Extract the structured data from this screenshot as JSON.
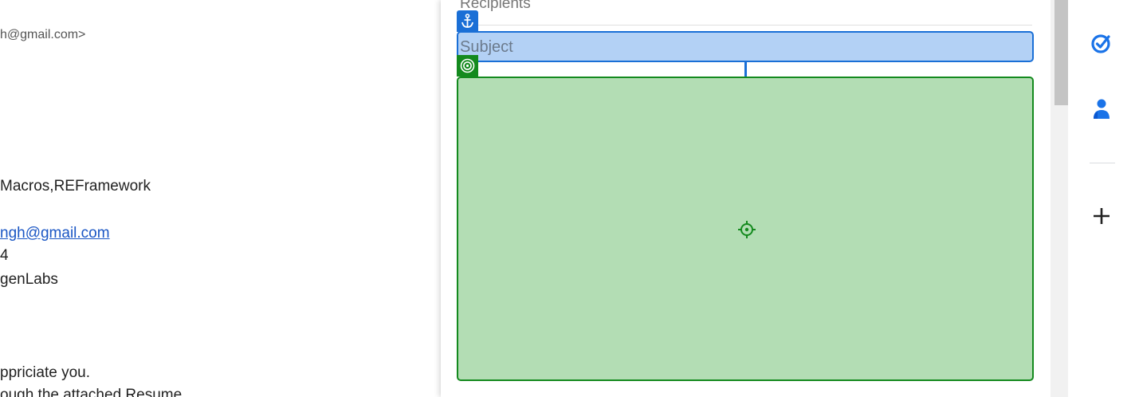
{
  "email": {
    "sender_email_fragment": "h@gmail.com>",
    "skills_fragment": "Macros,REFramework",
    "email_link_fragment": "ngh@gmail.com",
    "number_fragment": "4",
    "company_fragment": "genLabs",
    "appreciation_fragment": "ppriciate you.",
    "resume_fragment": "ough the attached Resume"
  },
  "compose": {
    "recipients_placeholder": "Recipients",
    "subject_placeholder": "Subject",
    "subject_highlight_color": "#b3d1f5",
    "subject_border_color": "#1a6fd6",
    "body_highlight_color": "#b3ddb4",
    "body_border_color": "#148a1e"
  },
  "icons": {
    "anchor_tag": "anchor-icon",
    "target_tag": "target-icon",
    "body_center": "crosshair-icon",
    "side_tasks": "tasks-icon",
    "side_contacts": "contacts-icon",
    "side_add": "add-icon"
  }
}
